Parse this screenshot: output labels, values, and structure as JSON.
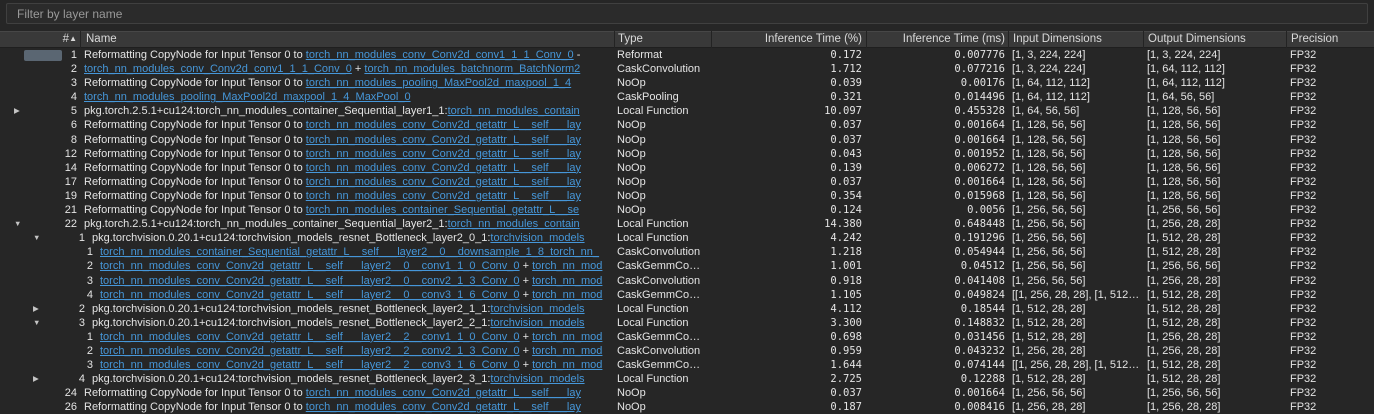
{
  "filter": {
    "placeholder": "Filter by layer name"
  },
  "colors": {
    "background": "#262626",
    "header_bg": "#393939",
    "row_text": "#e4e4e4",
    "link": "#4697d9",
    "filter_placeholder": "#999999",
    "selection_swatch": "#5a6672"
  },
  "table": {
    "columns": {
      "num": "#",
      "name": "Name",
      "type": "Type",
      "pct": "Inference Time (%)",
      "ms": "Inference Time (ms)",
      "input": "Input Dimensions",
      "output": "Output Dimensions",
      "precision": "Precision"
    },
    "sort_indicator": "▲",
    "icons": {
      "collapsed": "▶",
      "expanded": "▼"
    },
    "rows": [
      {
        "num": "1",
        "depth": 0,
        "arrow": "",
        "selected": true,
        "name": [
          {
            "t": "Reformatting CopyNode for Input Tensor 0 to ",
            "link": false
          },
          {
            "t": "torch_nn_modules_conv_Conv2d_conv1_1_1_Conv_0",
            "link": true
          },
          {
            "t": " -",
            "link": false
          }
        ],
        "type": "Reformat",
        "pct": "0.172",
        "ms": "0.007776",
        "in": "[1, 3, 224, 224]",
        "out": "[1, 3, 224, 224]",
        "prec": "FP32"
      },
      {
        "num": "2",
        "depth": 0,
        "arrow": "",
        "selected": false,
        "name": [
          {
            "t": "torch_nn_modules_conv_Conv2d_conv1_1_1_Conv_0",
            "link": true
          },
          {
            "t": " + ",
            "link": false
          },
          {
            "t": "torch_nn_modules_batchnorm_BatchNorm2",
            "link": true
          }
        ],
        "type": "CaskConvolution",
        "pct": "1.712",
        "ms": "0.077216",
        "in": "[1, 3, 224, 224]",
        "out": "[1, 64, 112, 112]",
        "prec": "FP32"
      },
      {
        "num": "3",
        "depth": 0,
        "arrow": "",
        "selected": false,
        "name": [
          {
            "t": "Reformatting CopyNode for Input Tensor 0 to ",
            "link": false
          },
          {
            "t": "torch_nn_modules_pooling_MaxPool2d_maxpool_1_4",
            "link": true
          }
        ],
        "type": "NoOp",
        "pct": "0.039",
        "ms": "0.00176",
        "in": "[1, 64, 112, 112]",
        "out": "[1, 64, 112, 112]",
        "prec": "FP32"
      },
      {
        "num": "4",
        "depth": 0,
        "arrow": "",
        "selected": false,
        "name": [
          {
            "t": "torch_nn_modules_pooling_MaxPool2d_maxpool_1_4_MaxPool_0",
            "link": true
          }
        ],
        "type": "CaskPooling",
        "pct": "0.321",
        "ms": "0.014496",
        "in": "[1, 64, 112, 112]",
        "out": "[1, 64, 56, 56]",
        "prec": "FP32"
      },
      {
        "num": "5",
        "depth": 0,
        "arrow": "collapsed",
        "selected": false,
        "name": [
          {
            "t": "pkg.torch.2.5.1+cu124:torch_nn_modules_container_Sequential_layer1_1:",
            "link": false
          },
          {
            "t": "torch_nn_modules_contain",
            "link": true
          }
        ],
        "type": "Local Function",
        "pct": "10.097",
        "ms": "0.455328",
        "in": "[1, 64, 56, 56]",
        "out": "[1, 128, 56, 56]",
        "prec": "FP32"
      },
      {
        "num": "6",
        "depth": 0,
        "arrow": "",
        "selected": false,
        "name": [
          {
            "t": "Reformatting CopyNode for Input Tensor 0 to ",
            "link": false
          },
          {
            "t": "torch_nn_modules_conv_Conv2d_getattr_L__self___lay",
            "link": true
          }
        ],
        "type": "NoOp",
        "pct": "0.037",
        "ms": "0.001664",
        "in": "[1, 128, 56, 56]",
        "out": "[1, 128, 56, 56]",
        "prec": "FP32"
      },
      {
        "num": "8",
        "depth": 0,
        "arrow": "",
        "selected": false,
        "name": [
          {
            "t": "Reformatting CopyNode for Input Tensor 0 to ",
            "link": false
          },
          {
            "t": "torch_nn_modules_conv_Conv2d_getattr_L__self___lay",
            "link": true
          }
        ],
        "type": "NoOp",
        "pct": "0.037",
        "ms": "0.001664",
        "in": "[1, 128, 56, 56]",
        "out": "[1, 128, 56, 56]",
        "prec": "FP32"
      },
      {
        "num": "12",
        "depth": 0,
        "arrow": "",
        "selected": false,
        "name": [
          {
            "t": "Reformatting CopyNode for Input Tensor 0 to ",
            "link": false
          },
          {
            "t": "torch_nn_modules_conv_Conv2d_getattr_L__self___lay",
            "link": true
          }
        ],
        "type": "NoOp",
        "pct": "0.043",
        "ms": "0.001952",
        "in": "[1, 128, 56, 56]",
        "out": "[1, 128, 56, 56]",
        "prec": "FP32"
      },
      {
        "num": "14",
        "depth": 0,
        "arrow": "",
        "selected": false,
        "name": [
          {
            "t": "Reformatting CopyNode for Input Tensor 0 to ",
            "link": false
          },
          {
            "t": "torch_nn_modules_conv_Conv2d_getattr_L__self___lay",
            "link": true
          }
        ],
        "type": "NoOp",
        "pct": "0.139",
        "ms": "0.006272",
        "in": "[1, 128, 56, 56]",
        "out": "[1, 128, 56, 56]",
        "prec": "FP32"
      },
      {
        "num": "17",
        "depth": 0,
        "arrow": "",
        "selected": false,
        "name": [
          {
            "t": "Reformatting CopyNode for Input Tensor 0 to ",
            "link": false
          },
          {
            "t": "torch_nn_modules_conv_Conv2d_getattr_L__self___lay",
            "link": true
          }
        ],
        "type": "NoOp",
        "pct": "0.037",
        "ms": "0.001664",
        "in": "[1, 128, 56, 56]",
        "out": "[1, 128, 56, 56]",
        "prec": "FP32"
      },
      {
        "num": "19",
        "depth": 0,
        "arrow": "",
        "selected": false,
        "name": [
          {
            "t": "Reformatting CopyNode for Input Tensor 0 to ",
            "link": false
          },
          {
            "t": "torch_nn_modules_conv_Conv2d_getattr_L__self___lay",
            "link": true
          }
        ],
        "type": "NoOp",
        "pct": "0.354",
        "ms": "0.015968",
        "in": "[1, 128, 56, 56]",
        "out": "[1, 128, 56, 56]",
        "prec": "FP32"
      },
      {
        "num": "21",
        "depth": 0,
        "arrow": "",
        "selected": false,
        "name": [
          {
            "t": "Reformatting CopyNode for Input Tensor 0 to ",
            "link": false
          },
          {
            "t": "torch_nn_modules_container_Sequential_getattr_L__se",
            "link": true
          }
        ],
        "type": "NoOp",
        "pct": "0.124",
        "ms": "0.0056",
        "in": "[1, 256, 56, 56]",
        "out": "[1, 256, 56, 56]",
        "prec": "FP32"
      },
      {
        "num": "22",
        "depth": 0,
        "arrow": "expanded",
        "selected": false,
        "name": [
          {
            "t": "pkg.torch.2.5.1+cu124:torch_nn_modules_container_Sequential_layer2_1:",
            "link": false
          },
          {
            "t": "torch_nn_modules_contain",
            "link": true
          }
        ],
        "type": "Local Function",
        "pct": "14.380",
        "ms": "0.648448",
        "in": "[1, 256, 56, 56]",
        "out": "[1, 256, 28, 28]",
        "prec": "FP32"
      },
      {
        "num": "1",
        "depth": 1,
        "arrow": "expanded",
        "selected": false,
        "name": [
          {
            "t": "pkg.torchvision.0.20.1+cu124:torchvision_models_resnet_Bottleneck_layer2_0_1:",
            "link": false
          },
          {
            "t": "torchvision_models",
            "link": true
          }
        ],
        "type": "Local Function",
        "pct": "4.242",
        "ms": "0.191296",
        "in": "[1, 256, 56, 56]",
        "out": "[1, 512, 28, 28]",
        "prec": "FP32"
      },
      {
        "num": "1",
        "depth": 2,
        "arrow": "",
        "selected": false,
        "name": [
          {
            "t": "torch_nn_modules_container_Sequential_getattr_L__self___layer2__0__downsample_1_8_torch_nn_",
            "link": true
          }
        ],
        "type": "CaskConvolution",
        "pct": "1.218",
        "ms": "0.054944",
        "in": "[1, 256, 56, 56]",
        "out": "[1, 512, 28, 28]",
        "prec": "FP32"
      },
      {
        "num": "2",
        "depth": 2,
        "arrow": "",
        "selected": false,
        "name": [
          {
            "t": "torch_nn_modules_conv_Conv2d_getattr_L__self___layer2__0__conv1_1_0_Conv_0",
            "link": true
          },
          {
            "t": " + ",
            "link": false
          },
          {
            "t": "torch_nn_mod",
            "link": true
          }
        ],
        "type": "CaskGemmCo…",
        "pct": "1.001",
        "ms": "0.04512",
        "in": "[1, 256, 56, 56]",
        "out": "[1, 256, 56, 56]",
        "prec": "FP32"
      },
      {
        "num": "3",
        "depth": 2,
        "arrow": "",
        "selected": false,
        "name": [
          {
            "t": "torch_nn_modules_conv_Conv2d_getattr_L__self___layer2__0__conv2_1_3_Conv_0",
            "link": true
          },
          {
            "t": " + ",
            "link": false
          },
          {
            "t": "torch_nn_mod",
            "link": true
          }
        ],
        "type": "CaskConvolution",
        "pct": "0.918",
        "ms": "0.041408",
        "in": "[1, 256, 56, 56]",
        "out": "[1, 256, 28, 28]",
        "prec": "FP32"
      },
      {
        "num": "4",
        "depth": 2,
        "arrow": "",
        "selected": false,
        "name": [
          {
            "t": "torch_nn_modules_conv_Conv2d_getattr_L__self___layer2__0__conv3_1_6_Conv_0",
            "link": true
          },
          {
            "t": " + ",
            "link": false
          },
          {
            "t": "torch_nn_mod",
            "link": true
          }
        ],
        "type": "CaskGemmCo…",
        "pct": "1.105",
        "ms": "0.049824",
        "in": "[[1, 256, 28, 28], [1, 512…",
        "out": "[1, 512, 28, 28]",
        "prec": "FP32"
      },
      {
        "num": "2",
        "depth": 1,
        "arrow": "collapsed",
        "selected": false,
        "name": [
          {
            "t": "pkg.torchvision.0.20.1+cu124:torchvision_models_resnet_Bottleneck_layer2_1_1:",
            "link": false
          },
          {
            "t": "torchvision_models",
            "link": true
          }
        ],
        "type": "Local Function",
        "pct": "4.112",
        "ms": "0.18544",
        "in": "[1, 512, 28, 28]",
        "out": "[1, 512, 28, 28]",
        "prec": "FP32"
      },
      {
        "num": "3",
        "depth": 1,
        "arrow": "expanded",
        "selected": false,
        "name": [
          {
            "t": "pkg.torchvision.0.20.1+cu124:torchvision_models_resnet_Bottleneck_layer2_2_1:",
            "link": false
          },
          {
            "t": "torchvision_models",
            "link": true
          }
        ],
        "type": "Local Function",
        "pct": "3.300",
        "ms": "0.148832",
        "in": "[1, 512, 28, 28]",
        "out": "[1, 512, 28, 28]",
        "prec": "FP32"
      },
      {
        "num": "1",
        "depth": 2,
        "arrow": "",
        "selected": false,
        "name": [
          {
            "t": "torch_nn_modules_conv_Conv2d_getattr_L__self___layer2__2__conv1_1_0_Conv_0",
            "link": true
          },
          {
            "t": " + ",
            "link": false
          },
          {
            "t": "torch_nn_mod",
            "link": true
          }
        ],
        "type": "CaskGemmCo…",
        "pct": "0.698",
        "ms": "0.031456",
        "in": "[1, 512, 28, 28]",
        "out": "[1, 256, 28, 28]",
        "prec": "FP32"
      },
      {
        "num": "2",
        "depth": 2,
        "arrow": "",
        "selected": false,
        "name": [
          {
            "t": "torch_nn_modules_conv_Conv2d_getattr_L__self___layer2__2__conv2_1_3_Conv_0",
            "link": true
          },
          {
            "t": " + ",
            "link": false
          },
          {
            "t": "torch_nn_mod",
            "link": true
          }
        ],
        "type": "CaskConvolution",
        "pct": "0.959",
        "ms": "0.043232",
        "in": "[1, 256, 28, 28]",
        "out": "[1, 256, 28, 28]",
        "prec": "FP32"
      },
      {
        "num": "3",
        "depth": 2,
        "arrow": "",
        "selected": false,
        "name": [
          {
            "t": "torch_nn_modules_conv_Conv2d_getattr_L__self___layer2__2__conv3_1_6_Conv_0",
            "link": true
          },
          {
            "t": " + ",
            "link": false
          },
          {
            "t": "torch_nn_mod",
            "link": true
          }
        ],
        "type": "CaskGemmCo…",
        "pct": "1.644",
        "ms": "0.074144",
        "in": "[[1, 256, 28, 28], [1, 512…",
        "out": "[1, 512, 28, 28]",
        "prec": "FP32"
      },
      {
        "num": "4",
        "depth": 1,
        "arrow": "collapsed",
        "selected": false,
        "name": [
          {
            "t": "pkg.torchvision.0.20.1+cu124:torchvision_models_resnet_Bottleneck_layer2_3_1:",
            "link": false
          },
          {
            "t": "torchvision_models",
            "link": true
          }
        ],
        "type": "Local Function",
        "pct": "2.725",
        "ms": "0.12288",
        "in": "[1, 512, 28, 28]",
        "out": "[1, 512, 28, 28]",
        "prec": "FP32"
      },
      {
        "num": "24",
        "depth": 0,
        "arrow": "",
        "selected": false,
        "name": [
          {
            "t": "Reformatting CopyNode for Input Tensor 0 to ",
            "link": false
          },
          {
            "t": "torch_nn_modules_conv_Conv2d_getattr_L__self___lay",
            "link": true
          }
        ],
        "type": "NoOp",
        "pct": "0.037",
        "ms": "0.001664",
        "in": "[1, 256, 56, 56]",
        "out": "[1, 256, 56, 56]",
        "prec": "FP32"
      },
      {
        "num": "26",
        "depth": 0,
        "arrow": "",
        "selected": false,
        "name": [
          {
            "t": "Reformatting CopyNode for Input Tensor 0 to ",
            "link": false
          },
          {
            "t": "torch_nn_modules_conv_Conv2d_getattr_L__self___lay",
            "link": true
          }
        ],
        "type": "NoOp",
        "pct": "0.187",
        "ms": "0.008416",
        "in": "[1, 256, 28, 28]",
        "out": "[1, 256, 28, 28]",
        "prec": "FP32"
      }
    ]
  }
}
